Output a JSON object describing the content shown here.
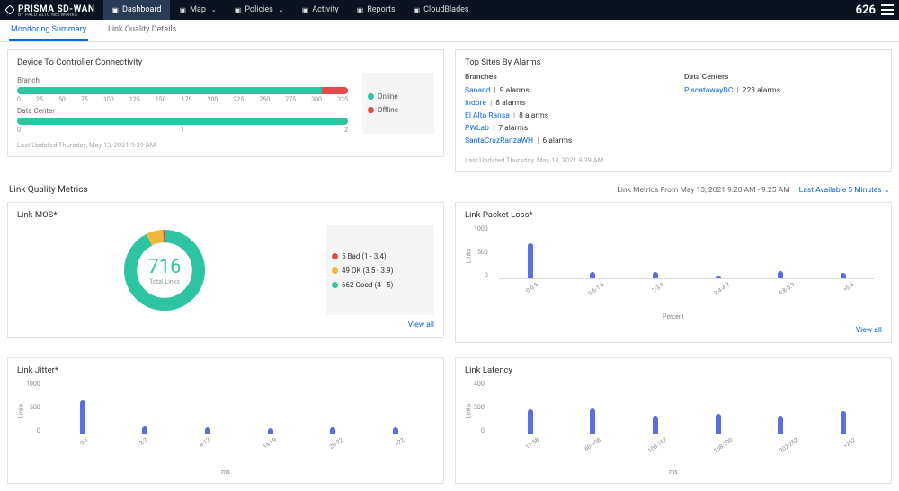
{
  "brand": {
    "name": "PRISMA SD-WAN",
    "sub": "BY PALO ALTO NETWORKS"
  },
  "nav": {
    "items": [
      {
        "label": "Dashboard",
        "has_caret": false,
        "active": true
      },
      {
        "label": "Map",
        "has_caret": true,
        "active": false
      },
      {
        "label": "Policies",
        "has_caret": true,
        "active": false
      },
      {
        "label": "Activity",
        "has_caret": false,
        "active": false
      },
      {
        "label": "Reports",
        "has_caret": false,
        "active": false
      },
      {
        "label": "CloudBlades",
        "has_caret": false,
        "active": false
      }
    ],
    "right_number": "626"
  },
  "subtabs": [
    {
      "label": "Monitoring Summary",
      "active": true
    },
    {
      "label": "Link Quality Details",
      "active": false
    }
  ],
  "connectivity": {
    "title": "Device To Controller Connectivity",
    "rows": [
      {
        "label": "Branch",
        "ticks": [
          "0",
          "25",
          "50",
          "75",
          "100",
          "125",
          "150",
          "175",
          "200",
          "225",
          "250",
          "275",
          "300",
          "325"
        ],
        "offline_pct": 8
      },
      {
        "label": "Data Center",
        "ticks": [
          "0",
          "1",
          "2"
        ],
        "offline_pct": 0
      }
    ],
    "legend": {
      "online": "Online",
      "offline": "Offline",
      "online_color": "#2ec4a1",
      "offline_color": "#e34b4b"
    },
    "last_updated": "Last Updated Thursday, May 13, 2021 9:39 AM"
  },
  "top_sites": {
    "title": "Top Sites By Alarms",
    "branches_head": "Branches",
    "datacenters_head": "Data Centers",
    "branches": [
      {
        "site": "Sanand",
        "alarms_text": "9 alarms"
      },
      {
        "site": "Indore",
        "alarms_text": "8 alarms"
      },
      {
        "site": "El Alto Ransa",
        "alarms_text": "8 alarms"
      },
      {
        "site": "PWLab",
        "alarms_text": "7 alarms"
      },
      {
        "site": "SantaCruzRanzaWH",
        "alarms_text": "6 alarms"
      }
    ],
    "datacenters": [
      {
        "site": "PiscatawayDC",
        "alarms_text": "223 alarms"
      }
    ],
    "last_updated": "Last Updated Thursday, May 13, 2021 9:39 AM"
  },
  "link_quality": {
    "title": "Link Quality Metrics",
    "range_text": "Link Metrics From May 13, 2021 9:20 AM - 9:25 AM",
    "freshness": "Last Available 5 Minutes"
  },
  "mos": {
    "title": "Link MOS*",
    "total": "716",
    "total_label": "Total Links",
    "segments": [
      {
        "label": "Bad (1 - 3.4)",
        "count": 5,
        "color": "#e34b4b"
      },
      {
        "label": "OK (3.5 - 3.9)",
        "count": 49,
        "color": "#f2b63c"
      },
      {
        "label": "Good (4 - 5)",
        "count": 662,
        "color": "#2ec4a1"
      }
    ],
    "view_all": "View all"
  },
  "packet_loss": {
    "title": "Link Packet Loss*",
    "y_ticks": [
      "1000",
      "500",
      "0"
    ],
    "y_label": "Links",
    "x_label": "Percent",
    "categories": [
      "0-0.5",
      "0.6-1.5",
      "2-3.5",
      "3.4-4.7",
      "4.8-5.9",
      ">5.5"
    ],
    "values": [
      650,
      120,
      110,
      40,
      130,
      100
    ],
    "view_all": "View all"
  },
  "jitter": {
    "title": "Link Jitter*",
    "y_ticks": [
      "1000",
      "500",
      "0"
    ],
    "y_label": "Links",
    "x_label": "ms",
    "categories": [
      "0-1",
      "2-7",
      "8-13",
      "14-19",
      "20-22",
      ">22"
    ],
    "values": [
      620,
      130,
      120,
      100,
      120,
      110
    ]
  },
  "latency": {
    "title": "Link Latency",
    "y_ticks": [
      "400",
      "200",
      "0"
    ],
    "y_label": "Links",
    "x_label": "ms",
    "categories": [
      "11-58",
      "60-108",
      "108-157",
      "158-200",
      "202-252",
      ">252"
    ],
    "values": [
      180,
      190,
      130,
      150,
      130,
      170
    ]
  },
  "chart_data": [
    {
      "type": "bar",
      "title": "Device To Controller Connectivity — Branch (stacked)",
      "series": [
        {
          "name": "Online",
          "values": [
            300
          ]
        },
        {
          "name": "Offline",
          "values": [
            25
          ]
        }
      ],
      "categories": [
        "Branch"
      ],
      "xlim": [
        0,
        325
      ]
    },
    {
      "type": "bar",
      "title": "Device To Controller Connectivity — Data Center (stacked)",
      "series": [
        {
          "name": "Online",
          "values": [
            2
          ]
        },
        {
          "name": "Offline",
          "values": [
            0
          ]
        }
      ],
      "categories": [
        "Data Center"
      ],
      "xlim": [
        0,
        2
      ]
    },
    {
      "type": "pie",
      "title": "Link MOS* — 716 Total Links",
      "labels": [
        "Bad (1-3.4)",
        "OK (3.5-3.9)",
        "Good (4-5)"
      ],
      "values": [
        5,
        49,
        662
      ]
    },
    {
      "type": "bar",
      "title": "Link Packet Loss*",
      "categories": [
        "0-0.5",
        "0.6-1.5",
        "2-3.5",
        "3.4-4.7",
        "4.8-5.9",
        ">5.5"
      ],
      "values": [
        650,
        120,
        110,
        40,
        130,
        100
      ],
      "xlabel": "Percent",
      "ylabel": "Links",
      "ylim": [
        0,
        1000
      ]
    },
    {
      "type": "bar",
      "title": "Link Jitter*",
      "categories": [
        "0-1",
        "2-7",
        "8-13",
        "14-19",
        "20-22",
        ">22"
      ],
      "values": [
        620,
        130,
        120,
        100,
        120,
        110
      ],
      "xlabel": "ms",
      "ylabel": "Links",
      "ylim": [
        0,
        1000
      ]
    },
    {
      "type": "bar",
      "title": "Link Latency",
      "categories": [
        "11-58",
        "60-108",
        "108-157",
        "158-200",
        "202-252",
        ">252"
      ],
      "values": [
        180,
        190,
        130,
        150,
        130,
        170
      ],
      "xlabel": "ms",
      "ylabel": "Links",
      "ylim": [
        0,
        400
      ]
    }
  ]
}
